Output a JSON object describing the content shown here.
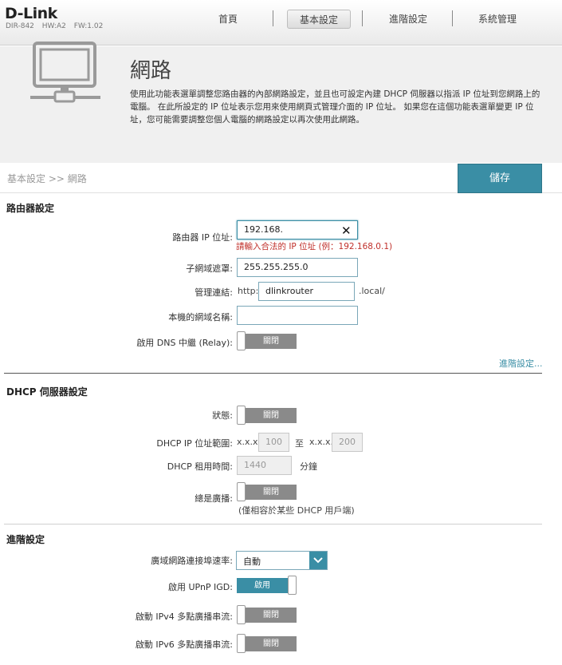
{
  "header": {
    "brand": "D-Link",
    "model": "DIR-842",
    "hw": "HW:A2",
    "fw": "FW:1.02",
    "nav": [
      "首頁",
      "基本設定",
      "進階設定",
      "系統管理"
    ],
    "active_nav": "基本設定"
  },
  "hero": {
    "title": "網路",
    "description": "使用此功能表選單調整您路由器的內部網路設定，並且也可設定內建 DHCP 伺服器以指派 IP 位址到您網路上的電腦。 在此所設定的 IP 位址表示您用來使用網頁式管理介面的 IP 位址。 如果您在這個功能表選單變更 IP 位址，您可能需要調整您個人電腦的網路設定以再次使用此網路。"
  },
  "breadcrumb": "基本設定 >> 網路",
  "save_label": "儲存",
  "router": {
    "title": "路由器設定",
    "ip_label": "路由器 IP 位址:",
    "ip_value": "192.168.",
    "ip_error": "請輸入合法的 IP 位址 (例：192.168.0.1)",
    "subnet_label": "子網域遮罩:",
    "subnet_value": "255.255.255.0",
    "mgmt_label": "管理連結:",
    "mgmt_prefix": "http://",
    "mgmt_value": "dlinkrouter",
    "mgmt_suffix": ".local/",
    "domain_label": "本機的網域名稱:",
    "domain_value": "",
    "dns_relay_label": "啟用 DNS 中繼 (Relay):",
    "dns_relay_state": "關閉",
    "advanced_link": "進階設定..."
  },
  "dhcp": {
    "title": "DHCP 伺服器設定",
    "status_label": "狀態:",
    "status_state": "關閉",
    "range_label": "DHCP IP 位址範圍:",
    "range_prefix": "x.x.x.",
    "range_start": "100",
    "range_to": "至",
    "range_end": "200",
    "lease_label": "DHCP 租用時間:",
    "lease_value": "1440",
    "lease_unit": "分鐘",
    "broadcast_label": "總是廣播:",
    "broadcast_state": "關閉",
    "broadcast_note": "(僅相容於某些 DHCP 用戶端)"
  },
  "advanced": {
    "title": "進階設定",
    "wan_speed_label": "廣域網路連接埠速率:",
    "wan_speed_value": "自動",
    "upnp_label": "啟用 UPnP IGD:",
    "upnp_state": "啟用",
    "ipv4_mc_label": "啟動 IPv4 多點廣播串流:",
    "ipv4_mc_state": "關閉",
    "ipv6_mc_label": "啟動 IPv6 多點廣播串流:",
    "ipv6_mc_state": "關閉"
  }
}
